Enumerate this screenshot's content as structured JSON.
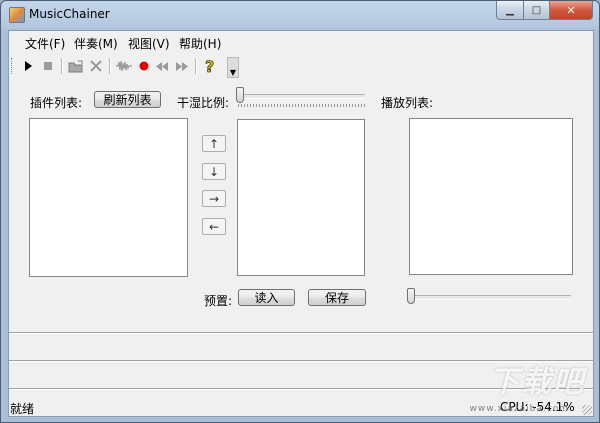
{
  "window": {
    "title": "MusicChainer"
  },
  "menu": [
    {
      "label": "文件(F)"
    },
    {
      "label": "伴奏(M)"
    },
    {
      "label": "视图(V)"
    },
    {
      "label": "帮助(H)"
    }
  ],
  "toolbar": {
    "icons": [
      "play-icon",
      "stop-icon",
      "open-folder-icon",
      "delete-icon",
      "waveform-icon",
      "record-icon",
      "rewind-icon",
      "fast-forward-icon",
      "help-icon"
    ]
  },
  "plugins": {
    "label": "插件列表:",
    "refresh_button": "刷新列表"
  },
  "dry_wet": {
    "label": "干湿比例:"
  },
  "playlist": {
    "label": "播放列表:"
  },
  "arrows": {
    "up": "↑",
    "down": "↓",
    "right": "→",
    "left": "←"
  },
  "preset": {
    "label": "预置:",
    "load_button": "读入",
    "save_button": "保存"
  },
  "status": {
    "text": "就绪",
    "cpu": "CPU: -54.1%"
  },
  "watermark": {
    "text": "下载吧",
    "url": "www.xiazaiba.com"
  },
  "colors": {
    "record": "#e00000",
    "close": "#c7422a"
  }
}
